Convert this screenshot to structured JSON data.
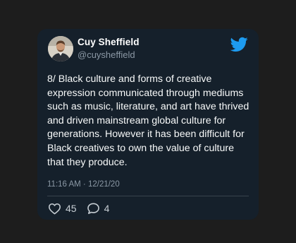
{
  "tweet": {
    "display_name": "Cuy Sheffield",
    "handle": "@cuysheffield",
    "text_lines": [
      "8/ Black culture and forms of creative",
      "expression communicated through mediums",
      "such as music, literature, and art have thrived",
      "and driven mainstream global culture for",
      "generations. However it has been difficult for",
      "Black creatives to own the value of culture",
      "that they produce."
    ],
    "timestamp": "11:16 AM · 12/21/20",
    "likes": "45",
    "replies": "4"
  },
  "icons": {
    "brand": "twitter-bird-icon",
    "like": "heart-icon",
    "reply": "speech-bubble-icon"
  },
  "colors": {
    "page_bg": "#1d1d1d",
    "card_bg": "#15202b",
    "brand_blue": "#1d9bf0",
    "primary_text": "#f7f9f9",
    "secondary_text": "#8b98a5"
  }
}
